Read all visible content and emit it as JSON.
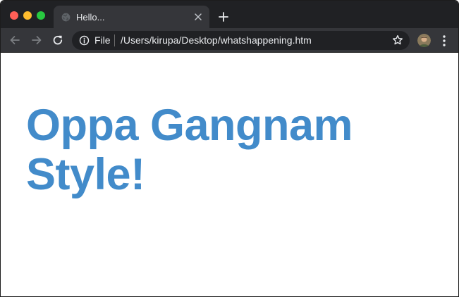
{
  "browser": {
    "tab": {
      "title": "Hello..."
    },
    "address_bar": {
      "scheme_label": "File",
      "url": "/Users/kirupa/Desktop/whatshappening.htm"
    },
    "icons": {
      "traffic_lights": [
        "close",
        "minimize",
        "zoom"
      ],
      "tab_favicon": "globe-icon",
      "tab_close": "close-icon",
      "new_tab": "plus-icon",
      "back": "arrow-left-icon",
      "forward": "arrow-right-icon",
      "reload": "reload-icon",
      "site_info": "info-icon",
      "bookmark": "star-icon",
      "profile": "avatar",
      "menu": "kebab-menu-icon"
    }
  },
  "page": {
    "heading": "Oppa Gangnam Style!"
  },
  "colors": {
    "tabstrip_bg": "#202124",
    "toolbar_bg": "#35363a",
    "omnibox_bg": "#202124",
    "traffic_red": "#ff5f57",
    "traffic_yellow": "#febc2e",
    "traffic_green": "#28c840",
    "heading": "#428bca"
  }
}
